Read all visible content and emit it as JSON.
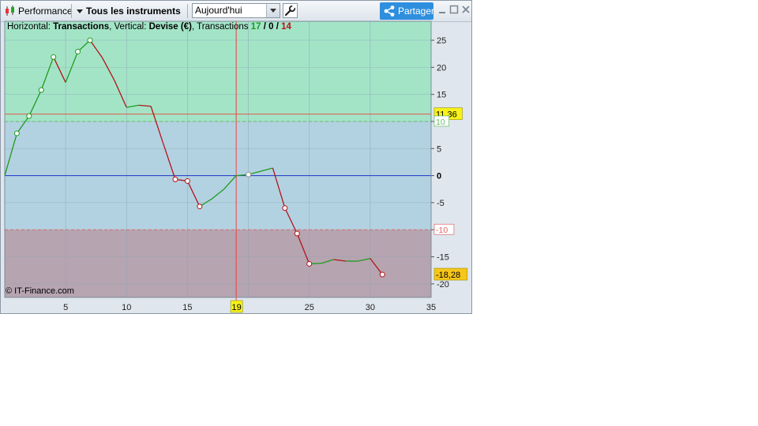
{
  "toolbar": {
    "performance_label": "Performance",
    "instruments_label": "Tous les instruments",
    "period_value": "Aujourd'hui",
    "share_label": "Partager",
    "icons": [
      "candlestick-icon",
      "dropdown-caret-icon",
      "wrench-icon",
      "share-icon",
      "minimize-icon",
      "maximize-icon",
      "close-icon"
    ]
  },
  "header": {
    "horizontal_prefix": "Horizontal: ",
    "horizontal_value": "Transactions",
    "vertical_prefix": ", Vertical: ",
    "vertical_value": "Devise (€)",
    "transactions_prefix": ", Transactions ",
    "wins": "17",
    "slash1": " / ",
    "neutral": "0",
    "slash2": " / ",
    "losses": "14"
  },
  "copyright": "© IT-Finance.com",
  "chart_data": {
    "type": "line",
    "xlabel": "",
    "ylabel": "",
    "xlim": [
      0,
      35
    ],
    "ylim": [
      -22.5,
      28.5
    ],
    "x_ticks": [
      5,
      10,
      15,
      20,
      25,
      30,
      35
    ],
    "y_ticks": [
      25,
      20,
      15,
      10,
      5,
      0,
      -5,
      -10,
      -15,
      -20
    ],
    "crosshair_x_label": "19",
    "bands": [
      {
        "from": 10,
        "to": 28.5,
        "color": "#a3e4c7"
      },
      {
        "from": -10,
        "to": 10,
        "color": "#b3d2e1"
      },
      {
        "from": -22.5,
        "to": -10,
        "color": "#b6a4b0"
      }
    ],
    "level_lines": [
      {
        "value": 11.36,
        "label": "11,36",
        "color": "#e8574d",
        "tag_bg": "#f6f21a"
      },
      {
        "value": -18.28,
        "label": "-18,28",
        "color": "#b42020",
        "tag_bg": "#f6c61a",
        "line": false
      },
      {
        "value": 10,
        "label": "10",
        "color": "#66bb66",
        "dashed": true
      },
      {
        "value": -10,
        "label": "-10",
        "color": "#e06666",
        "dashed": true
      },
      {
        "value": 0,
        "label": "0",
        "color": "#1f33c8"
      }
    ],
    "crosshair_x": 19,
    "points": [
      {
        "x": 0,
        "y": 0
      },
      {
        "x": 1,
        "y": 7.8
      },
      {
        "x": 2,
        "y": 11
      },
      {
        "x": 3,
        "y": 15.8
      },
      {
        "x": 4,
        "y": 21.9
      },
      {
        "x": 5,
        "y": 17.2
      },
      {
        "x": 6,
        "y": 22.9
      },
      {
        "x": 7,
        "y": 25
      },
      {
        "x": 8,
        "y": 21.8
      },
      {
        "x": 9,
        "y": 17.6
      },
      {
        "x": 10,
        "y": 12.6
      },
      {
        "x": 11,
        "y": 13
      },
      {
        "x": 12,
        "y": 12.8
      },
      {
        "x": 13,
        "y": 6
      },
      {
        "x": 14,
        "y": -0.7
      },
      {
        "x": 15,
        "y": -1
      },
      {
        "x": 16,
        "y": -5.7
      },
      {
        "x": 17,
        "y": -4.3
      },
      {
        "x": 18,
        "y": -2.5
      },
      {
        "x": 19,
        "y": 0
      },
      {
        "x": 20,
        "y": 0.2
      },
      {
        "x": 21,
        "y": 0.8
      },
      {
        "x": 22,
        "y": 1.4
      },
      {
        "x": 23,
        "y": -6
      },
      {
        "x": 24,
        "y": -10.7
      },
      {
        "x": 25,
        "y": -16.3
      },
      {
        "x": 26,
        "y": -16.2
      },
      {
        "x": 27,
        "y": -15.5
      },
      {
        "x": 28,
        "y": -15.8
      },
      {
        "x": 29,
        "y": -15.8
      },
      {
        "x": 30,
        "y": -15.3
      },
      {
        "x": 31,
        "y": -18.28
      }
    ],
    "markers": [
      1,
      2,
      3,
      4,
      6,
      7,
      14,
      15,
      16,
      20,
      23,
      24,
      25,
      31
    ],
    "up_color": "#1f9a1f",
    "down_color": "#b3141a"
  }
}
